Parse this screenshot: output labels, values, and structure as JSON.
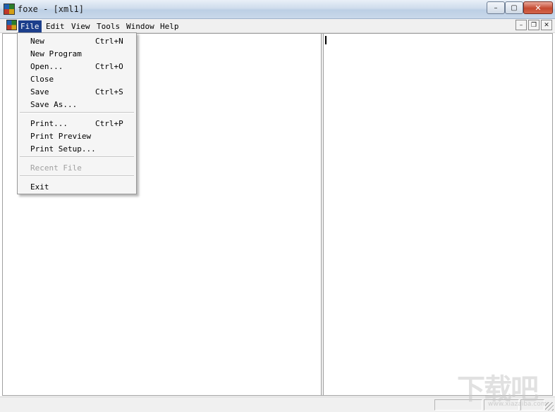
{
  "window": {
    "title": "foxe - [xml1]",
    "controls": {
      "minimize": "–",
      "maximize": "▢",
      "close": "✕"
    }
  },
  "menubar": {
    "items": [
      "File",
      "Edit",
      "View",
      "Tools",
      "Window",
      "Help"
    ],
    "active": "File",
    "mdi_controls": {
      "minimize": "–",
      "restore": "❐",
      "close": "✕"
    }
  },
  "file_menu": {
    "items": [
      {
        "label": "New",
        "accelerator": "Ctrl+N",
        "enabled": true
      },
      {
        "label": "New Program",
        "accelerator": "",
        "enabled": true
      },
      {
        "label": "Open...",
        "accelerator": "Ctrl+O",
        "enabled": true
      },
      {
        "label": "Close",
        "accelerator": "",
        "enabled": true
      },
      {
        "label": "Save",
        "accelerator": "Ctrl+S",
        "enabled": true
      },
      {
        "label": "Save As...",
        "accelerator": "",
        "enabled": true
      },
      {
        "label": "Print...",
        "accelerator": "Ctrl+P",
        "enabled": true
      },
      {
        "label": "Print Preview",
        "accelerator": "",
        "enabled": true
      },
      {
        "label": "Print Setup...",
        "accelerator": "",
        "enabled": true
      },
      {
        "label": "Recent File",
        "accelerator": "",
        "enabled": false
      },
      {
        "label": "Exit",
        "accelerator": "",
        "enabled": true
      }
    ]
  },
  "watermark": {
    "text": "下载吧",
    "url": "www.xiazaiba.com"
  },
  "colors": {
    "menu_highlight": "#1c3f8c",
    "disabled_text": "#a0a0a0",
    "close_button": "#c54a31"
  }
}
